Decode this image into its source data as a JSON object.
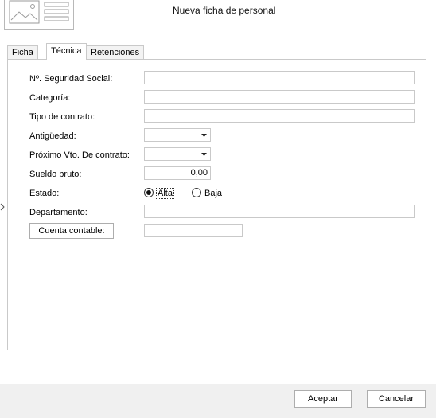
{
  "window": {
    "title": "Nueva ficha de personal"
  },
  "tabs": [
    {
      "label": "Ficha",
      "active": false
    },
    {
      "label": "Técnica",
      "active": true
    },
    {
      "label": "Retenciones",
      "active": false
    }
  ],
  "form": {
    "nss_label": "Nº. Seguridad Social:",
    "nss_value": "",
    "categoria_label": "Categoría:",
    "categoria_value": "",
    "tipo_contrato_label": "Tipo de contrato:",
    "tipo_contrato_value": "",
    "antiguedad_label": "Antigüedad:",
    "antiguedad_value": "",
    "proximo_vto_label": "Próximo Vto. De contrato:",
    "proximo_vto_value": "",
    "sueldo_label": "Sueldo bruto:",
    "sueldo_value": "0,00",
    "estado_label": "Estado:",
    "estado_options": [
      "Alta",
      "Baja"
    ],
    "estado_selected": "Alta",
    "departamento_label": "Departamento:",
    "departamento_value": "",
    "cuenta_button_label": "Cuenta contable:",
    "cuenta_value": ""
  },
  "footer": {
    "accept_label": "Aceptar",
    "cancel_label": "Cancelar"
  },
  "icons": {
    "photo": "image-placeholder-icon",
    "dropdown": "chevron-down-icon"
  }
}
